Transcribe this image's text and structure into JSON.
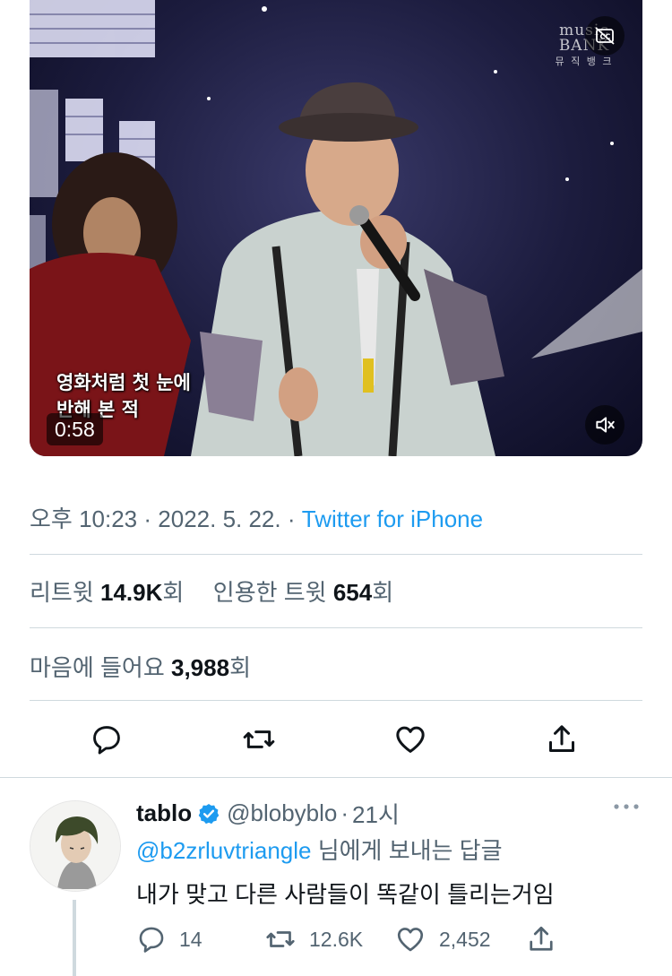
{
  "video": {
    "channel_logo": "music BANK",
    "channel_logo_sub": "뮤 직 뱅 크",
    "subtitle_line1": "영화처럼 첫 눈에",
    "subtitle_line2": "반해 본 적",
    "duration": "0:58",
    "cc_icon": "closed-captions-off-icon",
    "mute_icon": "speaker-muted-icon"
  },
  "tweet": {
    "time": "오후 10:23",
    "date": "2022. 5. 22.",
    "separator": "·",
    "client": "Twitter for iPhone",
    "retweets_label": "리트윗",
    "retweets_count": "14.9K",
    "retweets_unit": "회",
    "quotes_label": "인용한 트윗",
    "quotes_count": "654",
    "quotes_unit": "회",
    "likes_label": "마음에 들어요",
    "likes_count": "3,988",
    "likes_unit": "회",
    "accent_color": "#1d9bf0"
  },
  "reply": {
    "name": "tablo",
    "handle": "@blobyblo",
    "separator": "·",
    "time": "21시",
    "reply_to_mention": "@b2zrluvtriangle",
    "reply_to_suffix": " 님에게 보내는 답글",
    "text": "내가 맞고 다른 사람들이 똑같이 틀리는거임",
    "replies": "14",
    "retweets": "12.6K",
    "likes": "2,452"
  }
}
